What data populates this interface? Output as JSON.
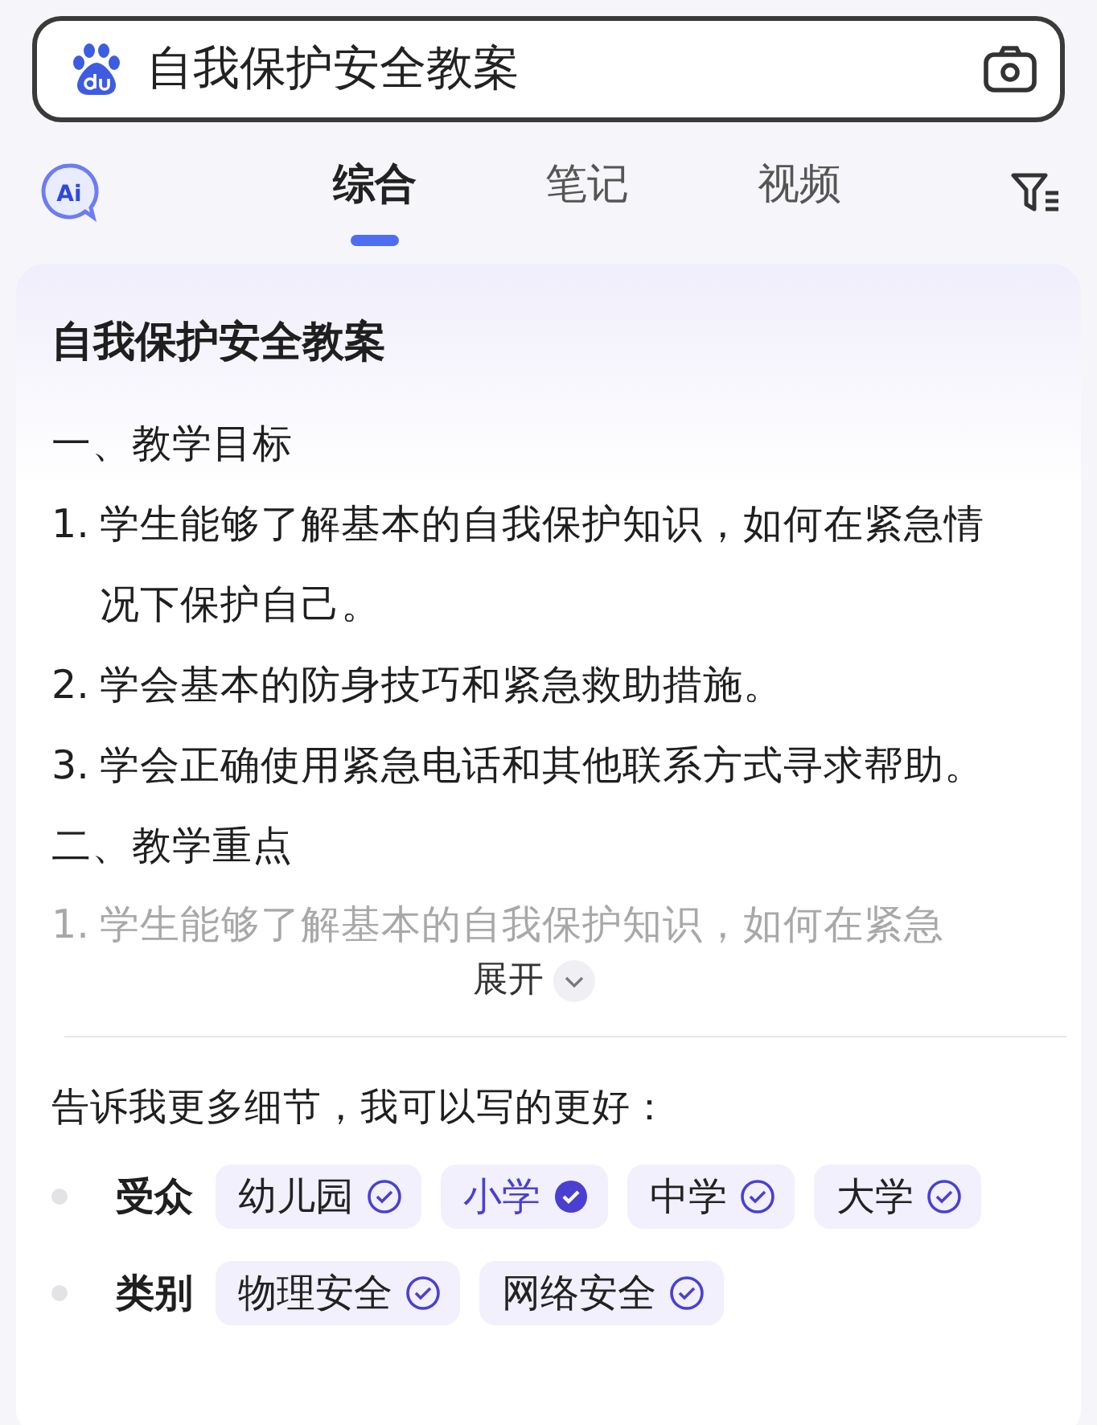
{
  "search": {
    "value": "自我保护安全教案"
  },
  "ai_badge": "Ai",
  "tabs": [
    {
      "label": "综合",
      "selected": true
    },
    {
      "label": "笔记",
      "selected": false
    },
    {
      "label": "视频",
      "selected": false
    }
  ],
  "answer": {
    "title": "自我保护安全教案",
    "lines": [
      {
        "kind": "heading",
        "text": "一、教学目标"
      },
      {
        "kind": "item",
        "number": "1.",
        "text": "学生能够了解基本的自我保护知识，如何在紧急情况下保护自己。"
      },
      {
        "kind": "item",
        "number": "2.",
        "text": "学会基本的防身技巧和紧急救助措施。"
      },
      {
        "kind": "item",
        "number": "3.",
        "text": "学会正确使用紧急电话和其他联系方式寻求帮助。"
      },
      {
        "kind": "heading",
        "text": "二、教学重点"
      },
      {
        "kind": "faded",
        "number": "1.",
        "text": "学生能够了解基本的自我保护知识，如何在紧急"
      }
    ],
    "expand_label": "展开"
  },
  "refine": {
    "prompt": "告诉我更多细节，我可以写的更好：",
    "groups": [
      {
        "label": "受众",
        "options": [
          {
            "label": "幼儿园",
            "selected": false
          },
          {
            "label": "小学",
            "selected": true
          },
          {
            "label": "中学",
            "selected": false
          },
          {
            "label": "大学",
            "selected": false
          }
        ]
      },
      {
        "label": "类别",
        "options": [
          {
            "label": "物理安全",
            "selected": false
          },
          {
            "label": "网络安全",
            "selected": false
          }
        ]
      }
    ]
  }
}
